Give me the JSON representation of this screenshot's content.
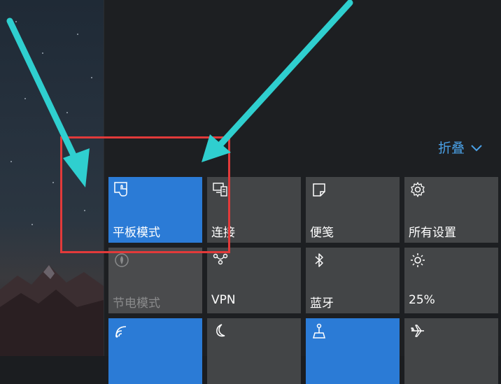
{
  "collapse": {
    "label": "折叠"
  },
  "tiles": [
    {
      "label": "平板模式",
      "icon": "tablet-mode-icon",
      "state": "on"
    },
    {
      "label": "连接",
      "icon": "connect-icon",
      "state": "off"
    },
    {
      "label": "便笺",
      "icon": "note-icon",
      "state": "off"
    },
    {
      "label": "所有设置",
      "icon": "settings-gear-icon",
      "state": "off"
    },
    {
      "label": "节电模式",
      "icon": "battery-saver-icon",
      "state": "disabled"
    },
    {
      "label": "VPN",
      "icon": "vpn-icon",
      "state": "off"
    },
    {
      "label": "蓝牙",
      "icon": "bluetooth-icon",
      "state": "off"
    },
    {
      "label": "25%",
      "icon": "brightness-icon",
      "state": "off"
    },
    {
      "label": "",
      "icon": "wifi-icon",
      "state": "on"
    },
    {
      "label": "",
      "icon": "quiet-hours-moon-icon",
      "state": "off"
    },
    {
      "label": "",
      "icon": "location-icon",
      "state": "on"
    },
    {
      "label": "",
      "icon": "airplane-icon",
      "state": "off"
    }
  ],
  "colors": {
    "accent": "#2b7bd6",
    "tile_off": "#434547",
    "panel_bg": "#1d1f22",
    "collapse_text": "#4aa0e6",
    "annotation_box": "#e23a3a",
    "annotation_arrow": "#2fcfcf"
  }
}
